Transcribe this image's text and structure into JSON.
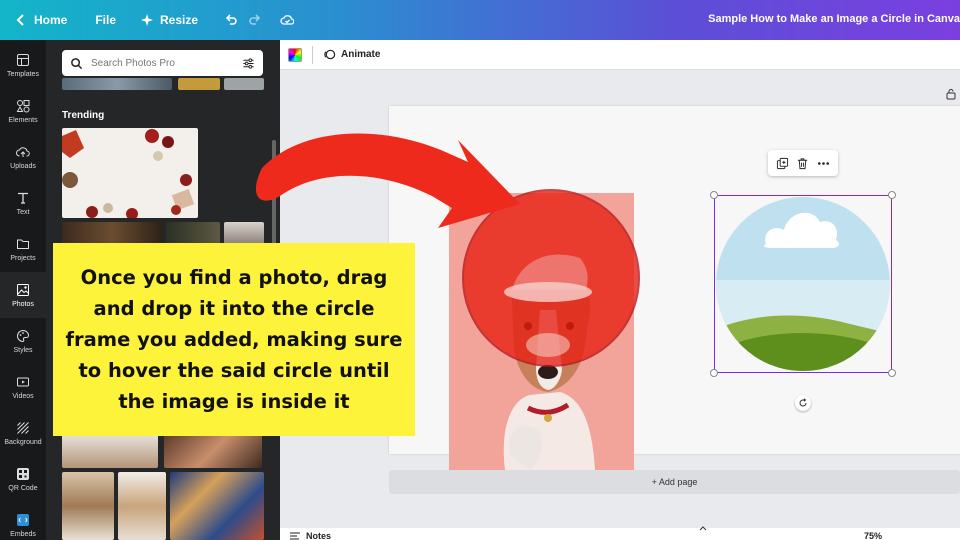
{
  "topbar": {
    "home_label": "Home",
    "file_label": "File",
    "resize_label": "Resize",
    "doc_title": "Sample How to Make an Image a Circle in Canva"
  },
  "rail": {
    "items": [
      {
        "label": "Templates",
        "icon": "templates-icon"
      },
      {
        "label": "Elements",
        "icon": "elements-icon"
      },
      {
        "label": "Uploads",
        "icon": "uploads-icon"
      },
      {
        "label": "Text",
        "icon": "text-icon"
      },
      {
        "label": "Projects",
        "icon": "folder-icon"
      },
      {
        "label": "Photos",
        "icon": "photos-icon"
      },
      {
        "label": "Styles",
        "icon": "palette-icon"
      },
      {
        "label": "Videos",
        "icon": "video-icon"
      },
      {
        "label": "Background",
        "icon": "background-icon"
      },
      {
        "label": "QR Code",
        "icon": "qr-code-icon"
      },
      {
        "label": "Embeds",
        "icon": "embeds-icon"
      }
    ],
    "active": "Photos"
  },
  "panel": {
    "search_placeholder": "Search Photos Pro",
    "heading": "Trending"
  },
  "toolbar": {
    "animate_label": "Animate"
  },
  "canvas": {
    "add_page_label": "+ Add page"
  },
  "bottom": {
    "notes_label": "Notes",
    "zoom": "75%"
  },
  "caption": {
    "text": "Once you find a photo, drag and drop it into the circle frame you added, making sure to hover the said circle until the image is inside it"
  },
  "colors": {
    "caption_bg": "#fdf33a",
    "arrow": "#ee2a1c",
    "selection": "#7d2ae8"
  }
}
